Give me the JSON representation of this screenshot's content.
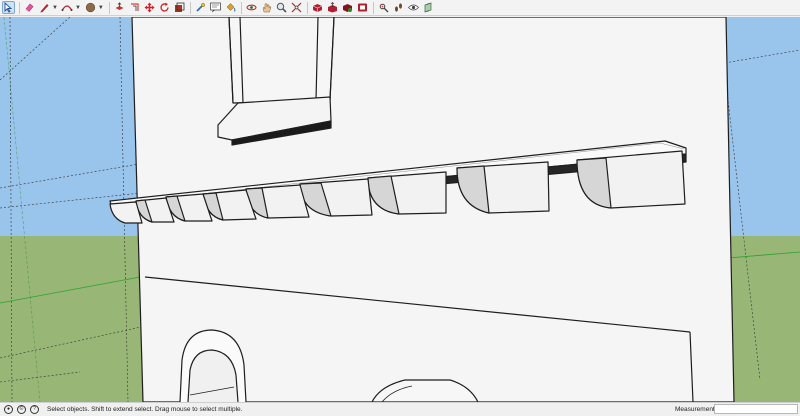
{
  "toolbar": {
    "tools": [
      {
        "name": "select-tool",
        "icon": "arrow-cursor-icon",
        "active": true,
        "color": "#1f4fa0"
      },
      {
        "name": "eraser-tool",
        "icon": "eraser-icon",
        "color": "#e0589c"
      },
      {
        "name": "line-tool",
        "icon": "pencil-icon",
        "color": "#b3202a",
        "dropdown": true
      },
      {
        "name": "arc-tool",
        "icon": "arc-icon",
        "color": "#b3202a",
        "dropdown": true
      },
      {
        "name": "shape-tool",
        "icon": "circle-shape-icon",
        "color": "#8b6b4a",
        "dropdown": true
      },
      {
        "name": "push-pull-tool",
        "icon": "push-pull-icon",
        "color": "#c0392b"
      },
      {
        "name": "offset-tool",
        "icon": "offset-icon",
        "color": "#d0453b"
      },
      {
        "name": "move-tool",
        "icon": "move-arrows-icon",
        "color": "#d0202a"
      },
      {
        "name": "rotate-tool",
        "icon": "rotate-icon",
        "color": "#d0202a"
      },
      {
        "name": "scale-tool",
        "icon": "scale-icon",
        "color": "#b03020"
      },
      {
        "name": "tape-measure-tool",
        "icon": "tape-measure-icon",
        "color": "#2a6bb5"
      },
      {
        "name": "text-tool",
        "icon": "text-icon",
        "color": "#333333"
      },
      {
        "name": "paint-bucket-tool",
        "icon": "paint-bucket-icon",
        "color": "#d8a030"
      },
      {
        "name": "orbit-tool",
        "icon": "orbit-icon",
        "color": "#c0282a"
      },
      {
        "name": "pan-tool",
        "icon": "hand-icon",
        "color": "#d09a60"
      },
      {
        "name": "zoom-tool",
        "icon": "zoom-icon",
        "color": "#555555"
      },
      {
        "name": "zoom-extents-tool",
        "icon": "zoom-extents-icon",
        "color": "#b0202a"
      },
      {
        "name": "warehouse-tool",
        "icon": "warehouse-icon",
        "color": "#b02030"
      },
      {
        "name": "share-model-tool",
        "icon": "share-model-icon",
        "color": "#b02030"
      },
      {
        "name": "extension-warehouse-tool",
        "icon": "extension-warehouse-icon",
        "color": "#b02030"
      },
      {
        "name": "layout-tool",
        "icon": "layout-icon",
        "color": "#b02030"
      },
      {
        "name": "position-camera-tool",
        "icon": "position-camera-icon",
        "color": "#444444"
      },
      {
        "name": "walk-tool",
        "icon": "footprints-icon",
        "color": "#6a4a2a"
      },
      {
        "name": "look-around-tool",
        "icon": "eye-icon",
        "color": "#444444"
      },
      {
        "name": "section-plane-tool",
        "icon": "section-plane-icon",
        "color": "#2a6a4a"
      }
    ]
  },
  "status": {
    "icons": [
      "geo-location-icon",
      "credits-icon",
      "help-icon"
    ],
    "hint": "Select objects. Shift to extend select. Drag mouse to select multiple.",
    "measurements_label": "Measurements",
    "measurements_value": ""
  },
  "scene": {
    "sky_color": "#99c4ec",
    "ground_color": "#98b676",
    "wall_color": "#f5f5f5",
    "edge_color": "#1e1e1e"
  }
}
